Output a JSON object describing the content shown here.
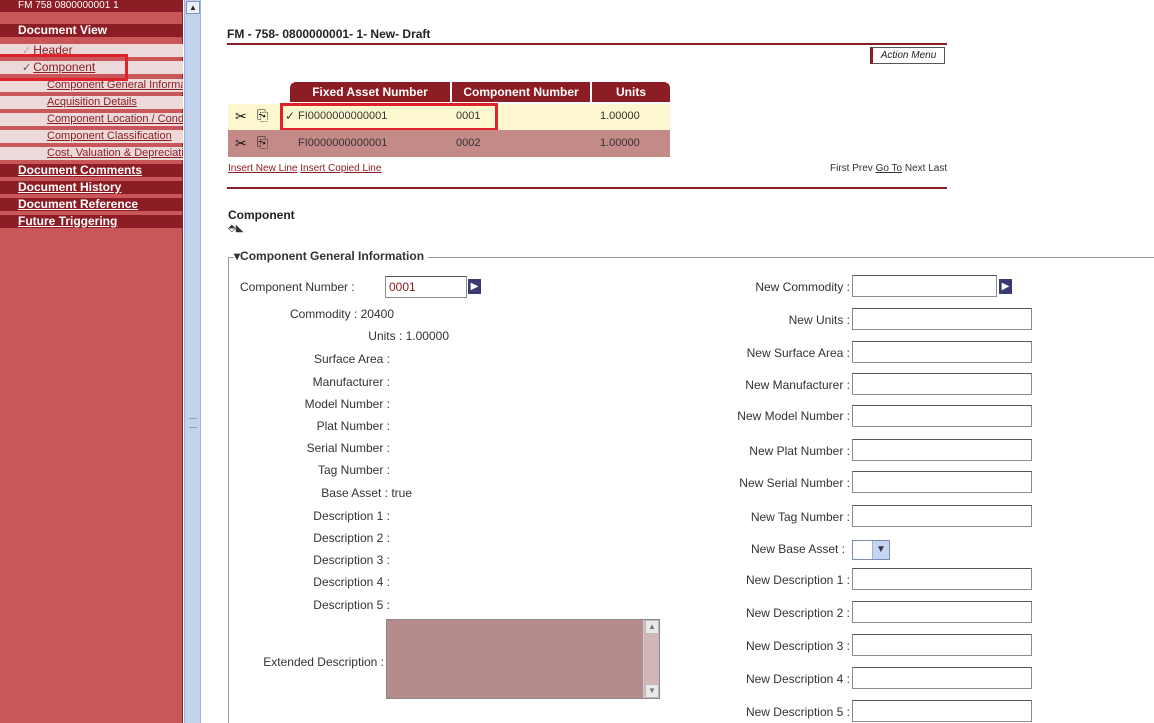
{
  "sidebar": {
    "top_title": "FM 758 0800000001 1",
    "document_view": "Document View",
    "items": [
      {
        "label": "Header"
      },
      {
        "label": "Component"
      }
    ],
    "sub_items": [
      {
        "label": "Component General Information"
      },
      {
        "label": "Acquisition Details"
      },
      {
        "label": "Component Location / Condition"
      },
      {
        "label": "Component Classification"
      },
      {
        "label": "Cost, Valuation & Depreciation"
      }
    ],
    "sections": [
      {
        "label": "Document Comments"
      },
      {
        "label": "Document History"
      },
      {
        "label": "Document Reference"
      },
      {
        "label": "Future Triggering"
      }
    ]
  },
  "page": {
    "title": "FM - 758- 0800000001- 1- New- Draft",
    "action_menu": "Action Menu"
  },
  "grid": {
    "columns": [
      "Fixed Asset Number",
      "Component Number",
      "Units"
    ],
    "rows": [
      {
        "check": "✓",
        "fixed_asset_number": "FI0000000000001",
        "component_number": "0001",
        "units": "1.00000"
      },
      {
        "check": "",
        "fixed_asset_number": "FI0000000000001",
        "component_number": "0002",
        "units": "1.00000"
      }
    ],
    "links": {
      "insert_new": "Insert New Line",
      "insert_copied": "Insert Copied Line"
    },
    "pager": {
      "first": "First",
      "prev": "Prev",
      "goto": "Go To",
      "next": "Next",
      "last": "Last"
    }
  },
  "component": {
    "section_title": "Component",
    "legend": "Component General Information",
    "left": {
      "component_number_label": "Component Number :",
      "component_number_value": "0001",
      "commodity": "Commodity : 20400",
      "units": "Units : 1.00000",
      "surface_area": "Surface Area :",
      "manufacturer": "Manufacturer :",
      "model_number": "Model Number :",
      "plat_number": "Plat Number :",
      "serial_number": "Serial Number :",
      "tag_number": "Tag Number :",
      "base_asset": "Base Asset : true",
      "description_1": "Description 1 :",
      "description_2": "Description 2 :",
      "description_3": "Description 3 :",
      "description_4": "Description 4 :",
      "description_5": "Description 5 :",
      "extended_description": "Extended Description :"
    },
    "right": {
      "new_commodity": "New Commodity :",
      "new_units": "New Units :",
      "new_surface_area": "New Surface Area :",
      "new_manufacturer": "New Manufacturer :",
      "new_model_number": "New Model Number :",
      "new_plat_number": "New Plat Number :",
      "new_serial_number": "New Serial Number :",
      "new_tag_number": "New Tag Number :",
      "new_base_asset": "New Base Asset :",
      "new_description_1": "New Description 1 :",
      "new_description_2": "New Description 2 :",
      "new_description_3": "New Description 3 :",
      "new_description_4": "New Description 4 :",
      "new_description_5": "New Description 5 :"
    }
  },
  "colors": {
    "brand": "#8c1d24",
    "sidebar": "#c9575a",
    "highlight": "#e0222a",
    "row_selected": "#fdf7cf"
  }
}
